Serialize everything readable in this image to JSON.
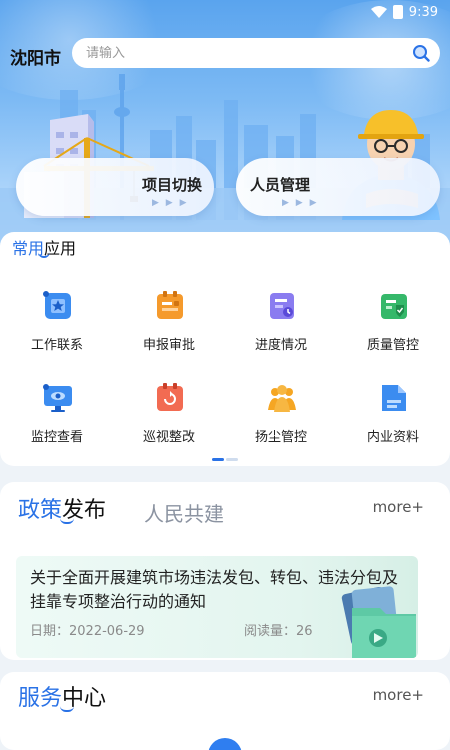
{
  "status": {
    "time": "9:39"
  },
  "header": {
    "city": "沈阳市",
    "search_placeholder": "请输入"
  },
  "hero": {
    "project_switch": "项目切换",
    "staff_manage": "人员管理",
    "arrows": "▶ ▶ ▶"
  },
  "apps": {
    "title_highlight": "常用",
    "title_rest": "应用",
    "items": [
      {
        "label": "工作联系",
        "icon": "work-contact-icon",
        "color": "#3b8cf0"
      },
      {
        "label": "申报审批",
        "icon": "approval-icon",
        "color": "#f59a2c"
      },
      {
        "label": "进度情况",
        "icon": "progress-icon",
        "color": "#8a7cf0"
      },
      {
        "label": "质量管控",
        "icon": "quality-icon",
        "color": "#35b86a"
      },
      {
        "label": "监控查看",
        "icon": "monitor-icon",
        "color": "#3b8cf0"
      },
      {
        "label": "巡视整改",
        "icon": "inspection-icon",
        "color": "#f26b52"
      },
      {
        "label": "扬尘管控",
        "icon": "dust-control-icon",
        "color": "#f5a623"
      },
      {
        "label": "内业资料",
        "icon": "documents-icon",
        "color": "#3b8cf0"
      }
    ]
  },
  "policy": {
    "tab_active_highlight": "政策",
    "tab_active_rest": "发布",
    "tab_other": "人民共建",
    "more": "more+",
    "news": {
      "headline": "关于全面开展建筑市场违法发包、转包、违法分包及挂靠专项整治行动的通知",
      "date": "日期：2022-06-29",
      "reads": "阅读量：26"
    }
  },
  "service": {
    "tab_highlight": "服务",
    "tab_rest": "中心",
    "more": "more+"
  },
  "colors": {
    "accent": "#2a72e6"
  }
}
